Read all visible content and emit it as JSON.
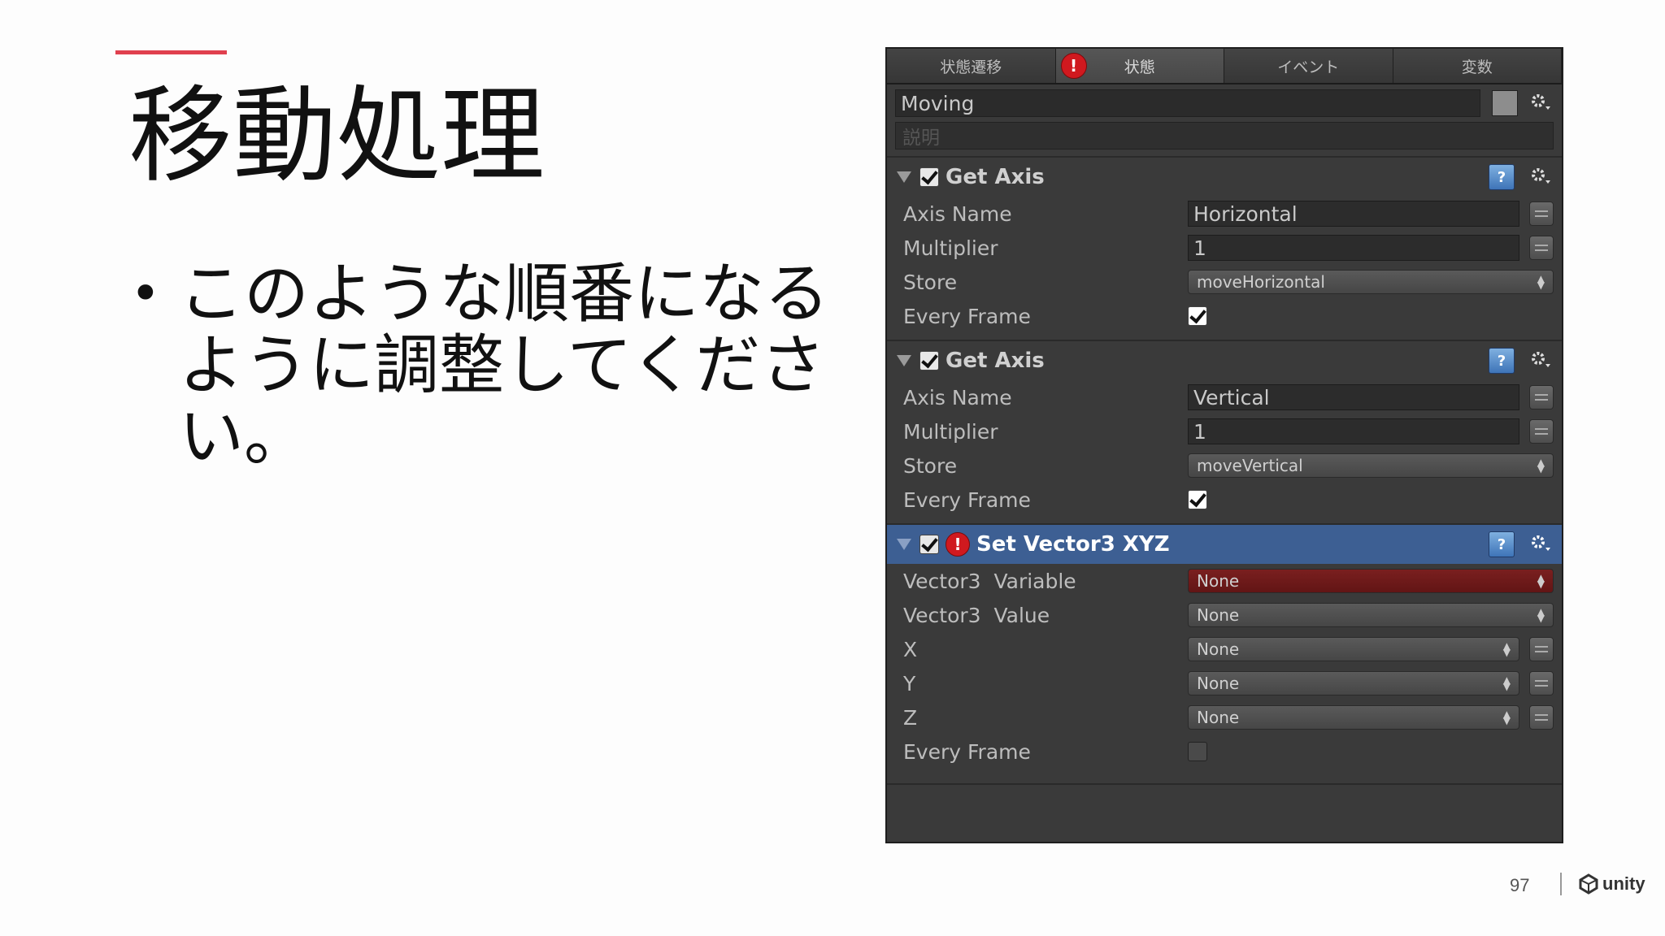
{
  "slide": {
    "title": "移動処理",
    "bullet": "このような順番になるように調整してください。",
    "page_number": "97",
    "logo_text": "unity"
  },
  "panel": {
    "tabs": [
      "状態遷移",
      "状態",
      "イベント",
      "変数"
    ],
    "state_name": "Moving",
    "description_placeholder": "説明",
    "actions": [
      {
        "title": "Get Axis",
        "fields": [
          {
            "label": "Axis Name",
            "value": "Horizontal"
          },
          {
            "label": "Multiplier",
            "value": "1"
          },
          {
            "label": "Store",
            "value": "moveHorizontal"
          },
          {
            "label": "Every Frame",
            "checked": true
          }
        ]
      },
      {
        "title": "Get Axis",
        "fields": [
          {
            "label": "Axis Name",
            "value": "Vertical"
          },
          {
            "label": "Multiplier",
            "value": "1"
          },
          {
            "label": "Store",
            "value": "moveVertical"
          },
          {
            "label": "Every Frame",
            "checked": true
          }
        ]
      },
      {
        "title": "Set Vector3 XYZ",
        "fields": [
          {
            "label": "Vector3  Variable",
            "value": "None"
          },
          {
            "label": "Vector3  Value",
            "value": "None"
          },
          {
            "label": "X",
            "value": "None"
          },
          {
            "label": "Y",
            "value": "None"
          },
          {
            "label": "Z",
            "value": "None"
          },
          {
            "label": "Every Frame",
            "checked": false
          }
        ]
      }
    ],
    "colors": {
      "selected_header": "#3d5f93",
      "error_red": "#d0191f",
      "accent_line": "#e0404e"
    }
  }
}
